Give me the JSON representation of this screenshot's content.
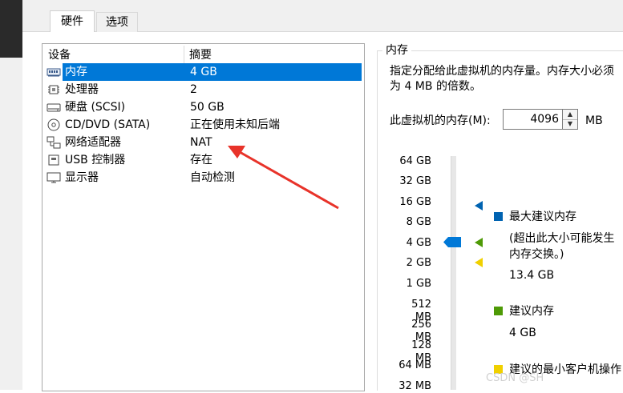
{
  "tabs": [
    {
      "label": "硬件"
    },
    {
      "label": "选项"
    }
  ],
  "device_list": {
    "columns": [
      "设备",
      "摘要"
    ],
    "rows": [
      {
        "name": "内存",
        "value": "4 GB",
        "icon": "memory-icon"
      },
      {
        "name": "处理器",
        "value": "2",
        "icon": "cpu-icon"
      },
      {
        "name": "硬盘 (SCSI)",
        "value": "50 GB",
        "icon": "harddisk-icon"
      },
      {
        "name": "CD/DVD (SATA)",
        "value": "正在使用未知后端",
        "icon": "cd-icon"
      },
      {
        "name": "网络适配器",
        "value": "NAT",
        "icon": "network-icon"
      },
      {
        "name": "USB 控制器",
        "value": "存在",
        "icon": "usb-icon"
      },
      {
        "name": "显示器",
        "value": "自动检测",
        "icon": "monitor-icon"
      }
    ]
  },
  "memory": {
    "title": "内存",
    "description": "指定分配给此虚拟机的内存量。内存大小必须为 4 MB 的倍数。",
    "label": "此虚拟机的内存(M):",
    "value": "4096",
    "unit": "MB",
    "scale": [
      "64 GB",
      "32 GB",
      "16 GB",
      "8 GB",
      "4 GB",
      "2 GB",
      "1 GB",
      "512 MB",
      "256 MB",
      "128 MB",
      "64 MB",
      "32 MB"
    ],
    "legend": {
      "max": {
        "label": "最大建议内存",
        "note": "(超出此大小可能发生内存交换。)",
        "value": "13.4 GB",
        "color": "#0063b1"
      },
      "recommended": {
        "label": "建议内存",
        "value": "4 GB",
        "color": "#4e9a06"
      },
      "min": {
        "label": "建议的最小客户机操作",
        "color": "#f0d000"
      }
    }
  },
  "watermark": "CSDN @SH",
  "colors": {
    "selection": "#0078d7",
    "arrow": "#e8332a"
  }
}
